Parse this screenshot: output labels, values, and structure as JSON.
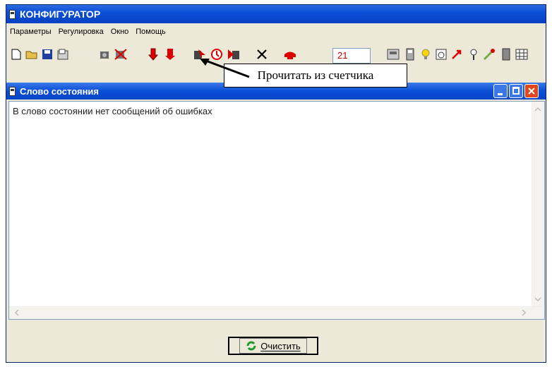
{
  "window": {
    "title": "КОНФИГУРАТОР"
  },
  "menu": [
    "Параметры",
    "Регулировка",
    "Окно",
    "Помощь"
  ],
  "toolbar": {
    "counter_value": "21"
  },
  "callout": {
    "text": "Прочитать из счетчика"
  },
  "child": {
    "title": "Слово состояния",
    "message": "В слово состоянии нет сообщений об ошибках",
    "clear_button": "Очистить"
  },
  "colors": {
    "title_blue": "#0a4ed6",
    "close_red": "#e0471d",
    "counter_red": "#c00000"
  },
  "icons": [
    "new-icon",
    "open-icon",
    "save-icon",
    "properties-icon",
    "connect-icon",
    "disconnect-icon",
    "download-icon",
    "upload-icon",
    "read-meter-icon",
    "clock-icon",
    "write-meter-icon",
    "delete-icon",
    "phone-icon",
    "meter-icon",
    "device-icon",
    "bulb-icon",
    "calendar-icon",
    "arrow-icon",
    "probe-icon",
    "tools-icon",
    "grid-icon"
  ]
}
